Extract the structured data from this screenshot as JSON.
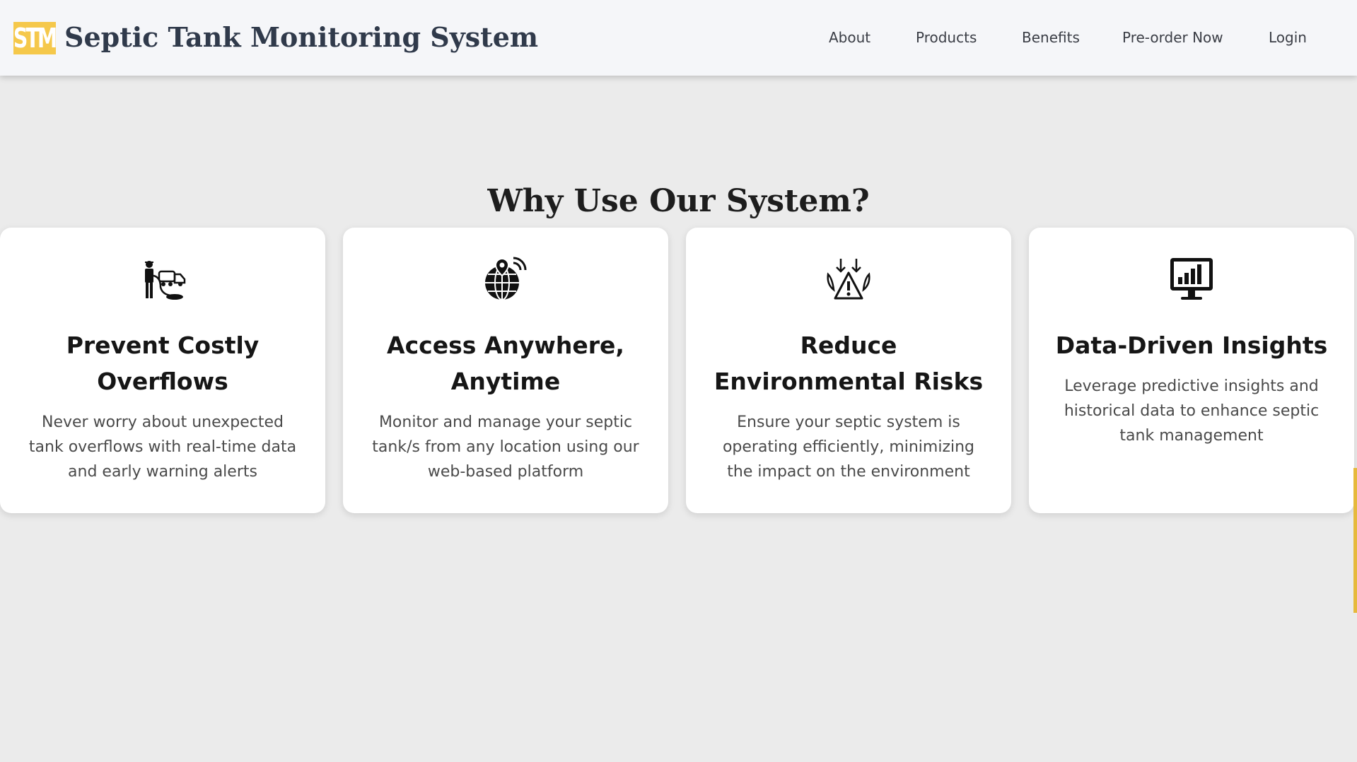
{
  "header": {
    "logo_text": "STM",
    "title": "Septic Tank Monitoring System",
    "nav": {
      "about": "About",
      "products": "Products",
      "benefits": "Benefits",
      "preorder": "Pre-order Now",
      "login": "Login"
    }
  },
  "section": {
    "title": "Why Use Our System?"
  },
  "cards": [
    {
      "icon": "worker-truck-icon",
      "title": "Prevent Costly Overflows",
      "description": "Never worry about unexpected tank overflows with real-time data and early warning alerts"
    },
    {
      "icon": "globe-location-icon",
      "title": "Access Anywhere, Anytime",
      "description": "Monitor and manage your septic tank/s from any location using our web-based platform"
    },
    {
      "icon": "environment-warning-icon",
      "title": "Reduce Environmental Risks",
      "description": "Ensure your septic system is operating efficiently, minimizing the impact on the environment"
    },
    {
      "icon": "analytics-monitor-icon",
      "title": "Data-Driven Insights",
      "description": "Leverage predictive insights and historical data to enhance septic tank management"
    }
  ],
  "colors": {
    "accent": "#f5c84b",
    "header_bg": "#f5f6f9",
    "page_bg": "#ebebeb"
  }
}
